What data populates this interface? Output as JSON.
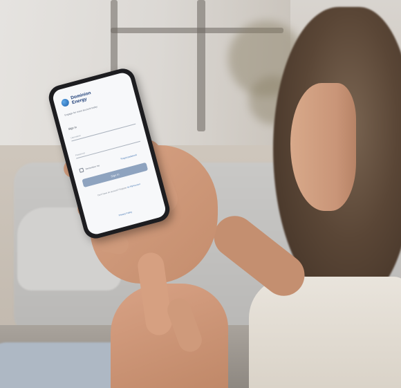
{
  "app": {
    "logo_text": "Dominion Energy",
    "logo_icon": "dominion-energy-logo-icon",
    "tagline": "Engage for more account today",
    "username_label": "Sign in",
    "username_placeholder": "Username",
    "password_placeholder": "Password",
    "remember_label": "Remember me",
    "forgot_link": "Forgot password",
    "signin_button": "Sign In",
    "help_text": "Don't have an account? Register",
    "help_link": "for MyAccount",
    "footer_link": "Privacy Policy"
  },
  "colors": {
    "brand_blue": "#1f3f78",
    "button": "#8ea3bf",
    "link": "#3a6fb0"
  }
}
